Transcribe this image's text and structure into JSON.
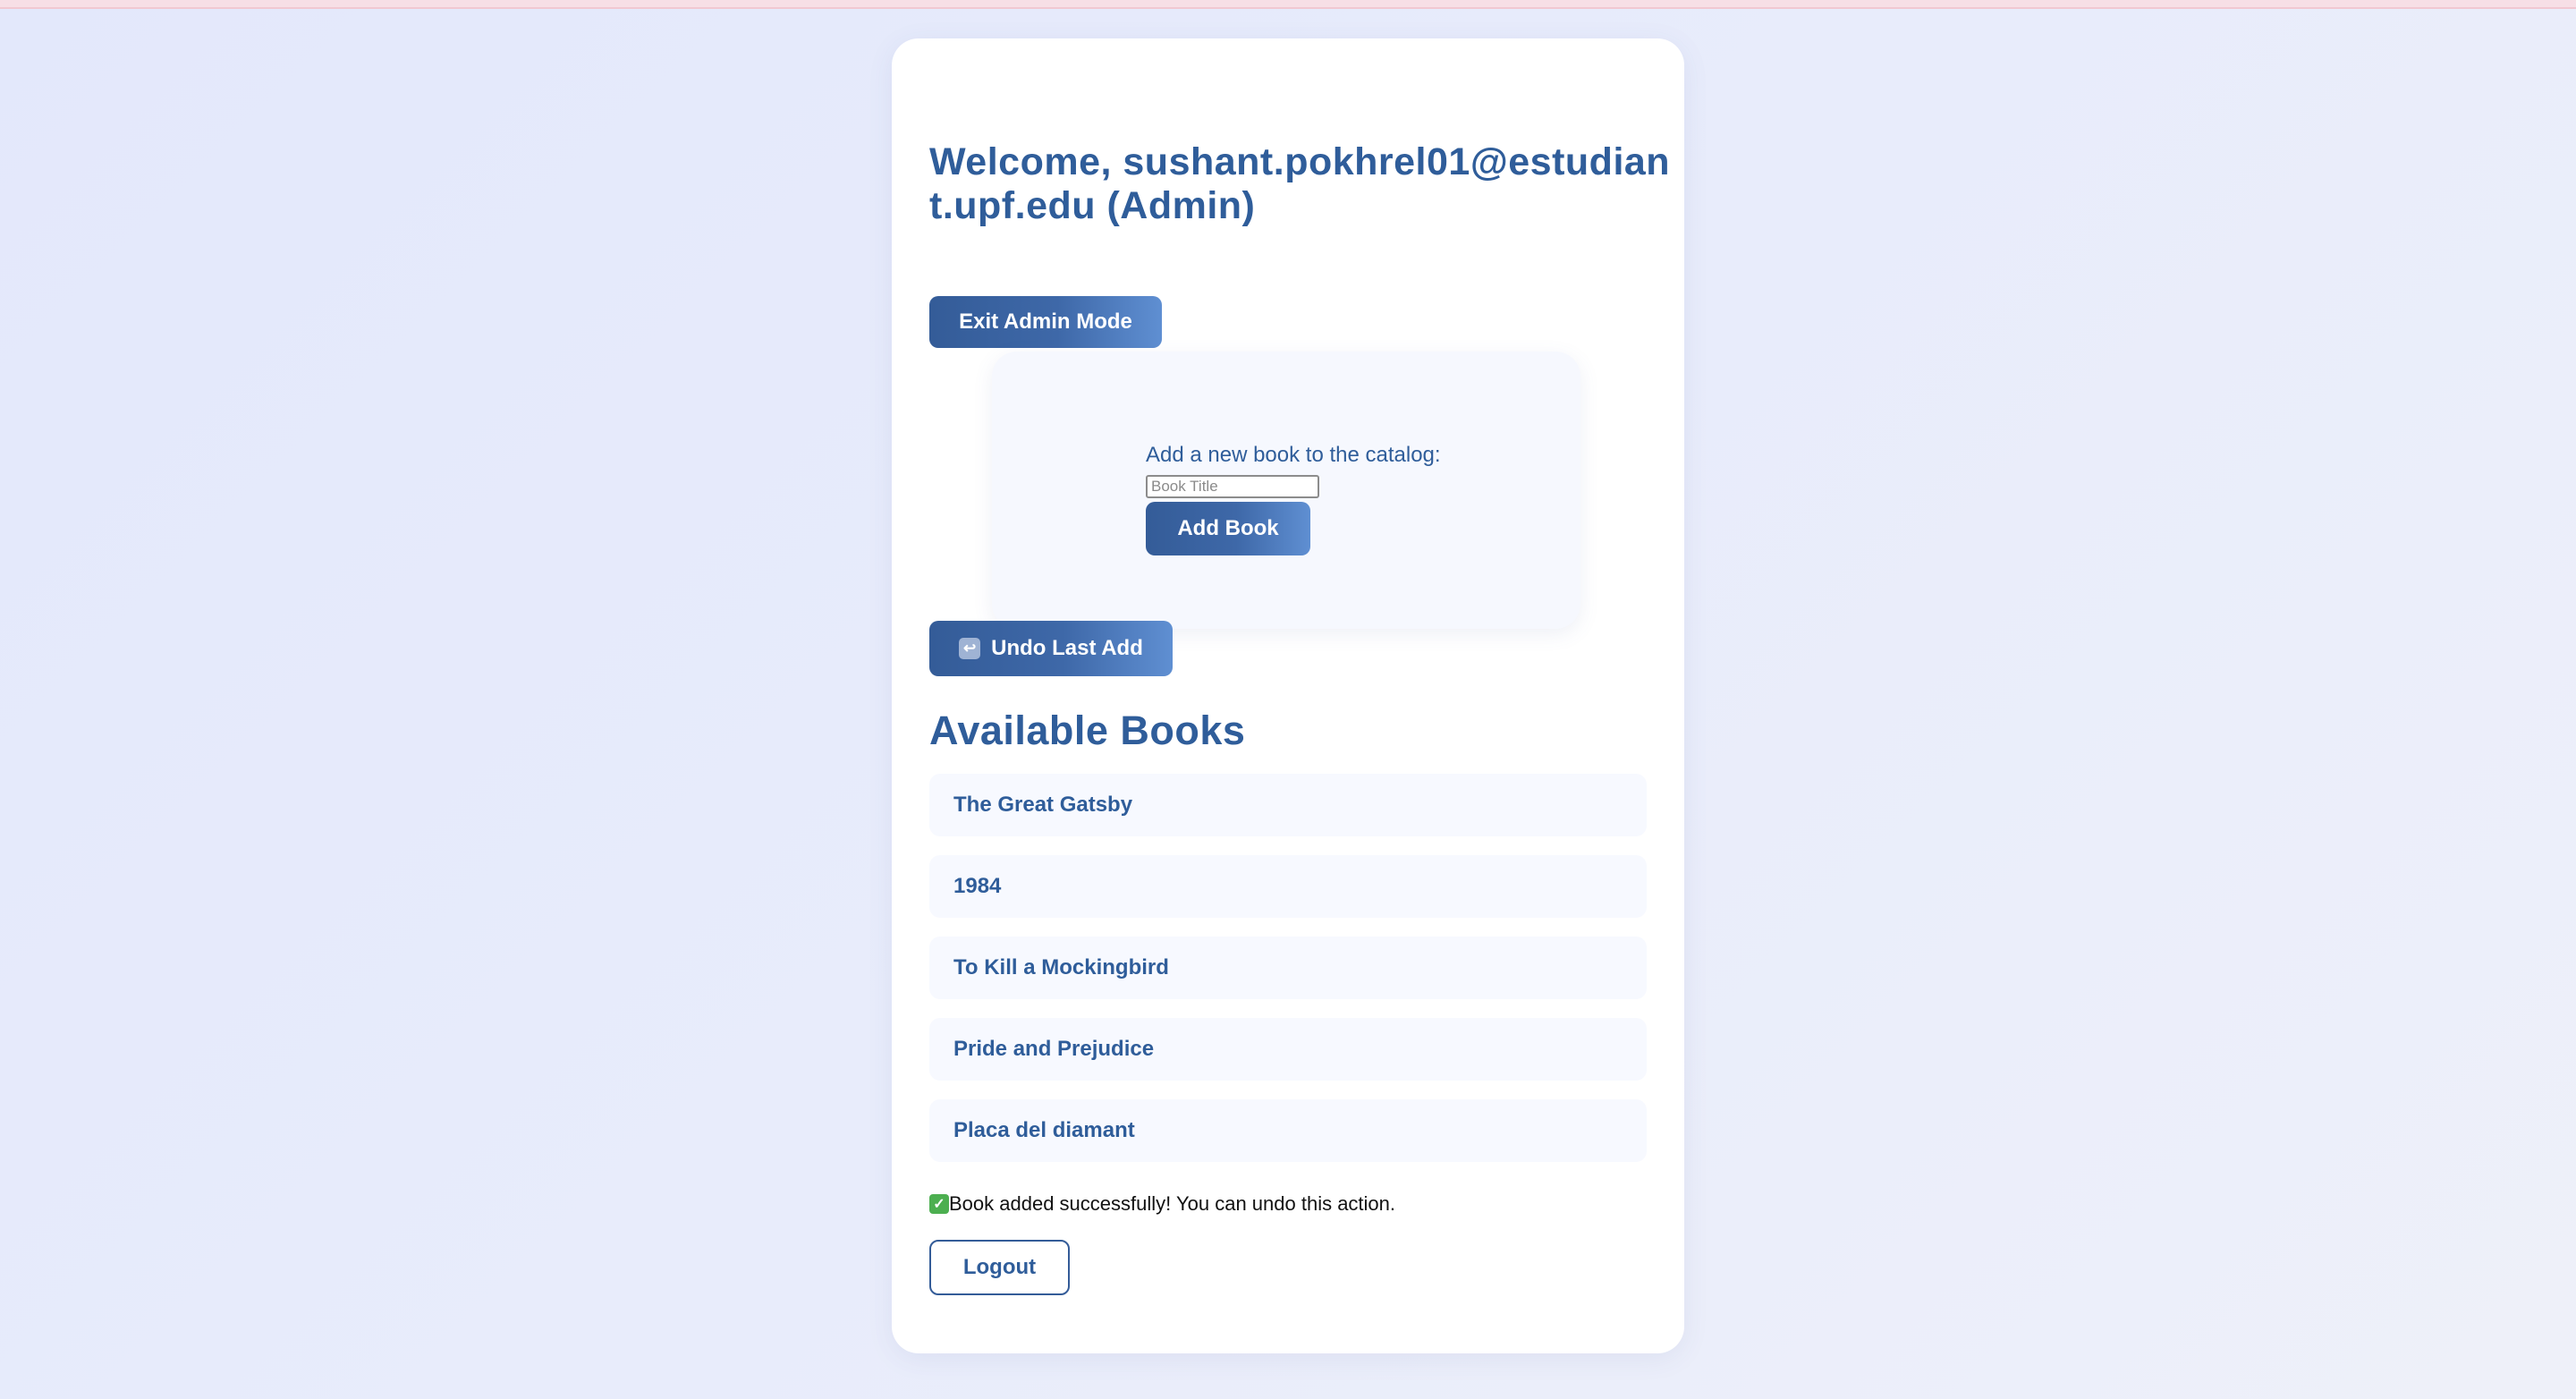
{
  "header": {
    "welcome": "Welcome, sushant.pokhrel01@estudiant.upf.edu (Admin)"
  },
  "admin": {
    "exit_label": "Exit Admin Mode"
  },
  "add_book": {
    "label": "Add a new book to the catalog:",
    "input_value": "",
    "input_placeholder": "Book Title",
    "button_label": "Add Book"
  },
  "undo": {
    "icon": "undo-arrow-icon",
    "label": "Undo Last Add"
  },
  "books": {
    "heading": "Available Books",
    "items": [
      "The Great Gatsby",
      "1984",
      "To Kill a Mockingbird",
      "Pride and Prejudice",
      "Placa del diamant"
    ]
  },
  "status": {
    "icon": "check-icon",
    "message": "Book added successfully! You can undo this action."
  },
  "logout": {
    "label": "Logout"
  },
  "colors": {
    "primary": "#2f5d9a",
    "button_gradient_start": "#345c98",
    "button_gradient_end": "#5f8fd2",
    "background": "#e6eafb",
    "success": "#4caf50"
  }
}
